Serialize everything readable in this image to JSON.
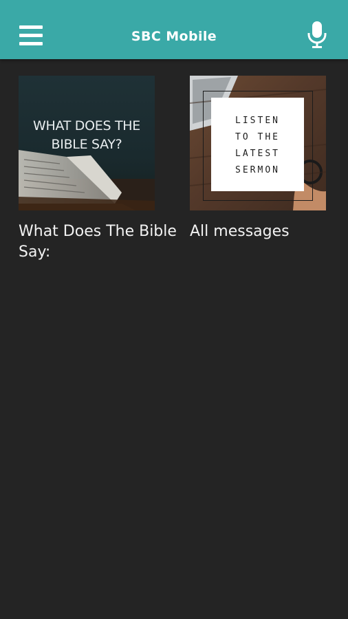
{
  "header": {
    "title": "SBC Mobile",
    "menu_icon": "hamburger-menu-icon",
    "mic_icon": "microphone-icon",
    "accent_color": "#3aa9a7"
  },
  "tiles": [
    {
      "title": "What Does The Bible Say:",
      "image_text": "WHAT DOES THE BIBLE SAY?"
    },
    {
      "title": "All messages",
      "image_text_lines": [
        "LISTEN",
        "TO THE",
        "LATEST",
        "SERMON"
      ]
    }
  ]
}
